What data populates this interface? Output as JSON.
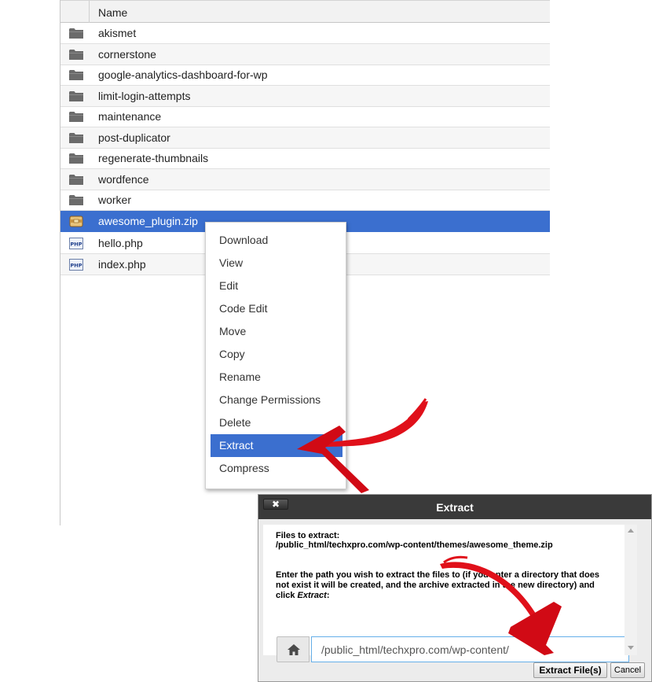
{
  "file_list": {
    "column_header": "Name",
    "rows": [
      {
        "name": "akismet",
        "icon": "folder-icon"
      },
      {
        "name": "cornerstone",
        "icon": "folder-icon"
      },
      {
        "name": "google-analytics-dashboard-for-wp",
        "icon": "folder-icon"
      },
      {
        "name": "limit-login-attempts",
        "icon": "folder-icon"
      },
      {
        "name": "maintenance",
        "icon": "folder-icon"
      },
      {
        "name": "post-duplicator",
        "icon": "folder-icon"
      },
      {
        "name": "regenerate-thumbnails",
        "icon": "folder-icon"
      },
      {
        "name": "wordfence",
        "icon": "folder-icon"
      },
      {
        "name": "worker",
        "icon": "folder-icon"
      },
      {
        "name": "awesome_plugin.zip",
        "icon": "zip-archive-icon",
        "selected": true
      },
      {
        "name": "hello.php",
        "icon": "php-file-icon"
      },
      {
        "name": "index.php",
        "icon": "php-file-icon"
      }
    ],
    "php_icon_text": "PHP"
  },
  "context_menu": {
    "items": [
      "Download",
      "View",
      "Edit",
      "Code Edit",
      "Move",
      "Copy",
      "Rename",
      "Change Permissions",
      "Delete",
      "Extract",
      "Compress"
    ],
    "highlighted": "Extract"
  },
  "extract_dialog": {
    "title": "Extract",
    "close_label": "✖",
    "files_label": "Files to extract:",
    "files_path": "/public_html/techxpro.com/wp-content/themes/awesome_theme.zip",
    "instructions_line1": "Enter the path you wish to extract the files to (if you enter a directory that does",
    "instructions_line2": "not exist it will be created, and the archive extracted in the new directory) and",
    "instructions_line3_prefix": "click ",
    "instructions_line3_em": "Extract",
    "instructions_line3_suffix": ":",
    "path_value": "/public_html/techxpro.com/wp-content/",
    "extract_button": "Extract File(s)",
    "cancel_button": "Cancel"
  },
  "colors": {
    "selection": "#3b6fcf",
    "annotation_arrow": "#e0101a",
    "dialog_titlebar": "#3a3a3a"
  }
}
